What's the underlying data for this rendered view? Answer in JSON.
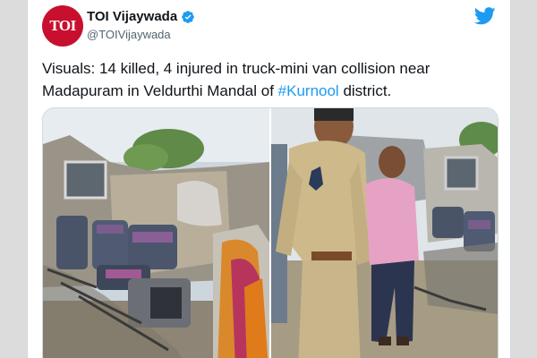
{
  "tweet": {
    "display_name": "TOI Vijaywada",
    "handle": "@TOIVijaywada",
    "avatar_text": "TOI",
    "verified": true,
    "text_before_hashtag": "Visuals: 14 killed, 4 injured in truck-mini van collision near Madapuram in Veldurthi Mandal of ",
    "hashtag": "#Kurnool",
    "text_after_hashtag": " district."
  },
  "icons": {
    "avatar": "toi-logo-icon",
    "verified": "verified-badge-icon",
    "brand": "twitter-bird-icon"
  },
  "colors": {
    "brand_red": "#c8102e",
    "link_blue": "#1d9bf0",
    "text": "#0f1419",
    "muted": "#536471",
    "page_bg": "#dcdcdc"
  },
  "media": {
    "count": 2,
    "photo_1": "truck-mini-van-wreckage-photo",
    "photo_2": "police-officer-at-crash-site-photo"
  }
}
